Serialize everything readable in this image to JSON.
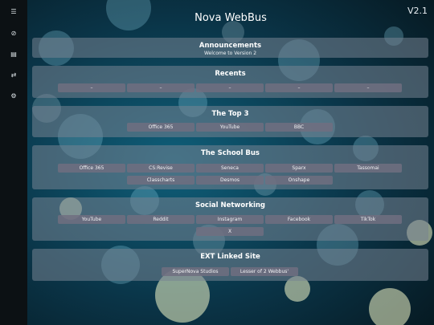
{
  "app": {
    "title": "Nova WebBus",
    "version": "V2.1"
  },
  "sidebar": {
    "icons": [
      "menu-icon",
      "globe-icon",
      "bars-icon",
      "swap-icon",
      "settings-icon"
    ]
  },
  "announcements": {
    "title": "Announcements",
    "subtitle": "Welcome to Version 2"
  },
  "recents": {
    "title": "Recents",
    "items": [
      "–",
      "–",
      "–",
      "–",
      "–"
    ]
  },
  "top3": {
    "title": "The Top 3",
    "items": [
      "Office 365",
      "YouTube",
      "BBC"
    ]
  },
  "school_bus": {
    "title": "The School Bus",
    "items": [
      "Office 365",
      "CS:Revise",
      "Seneca",
      "Sparx",
      "Tassomai",
      "Classcharts",
      "Desmos",
      "Onshape"
    ]
  },
  "social": {
    "title": "Social Networking",
    "items": [
      "YouTube",
      "Reddit",
      "Instagram",
      "Facebook",
      "TikTok",
      "X"
    ]
  },
  "ext": {
    "title": "EXT Linked Site",
    "items": [
      "SuperNova Studios",
      "Lesser of 2 Webbus'"
    ]
  }
}
